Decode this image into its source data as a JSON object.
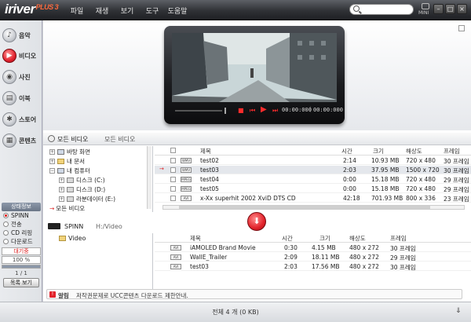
{
  "app": {
    "logo": "iriver",
    "logo_plus": "PLUS 3",
    "menu": [
      "파일",
      "재생",
      "보기",
      "도구",
      "도움말"
    ],
    "mini_label": "MINI"
  },
  "sidebar": {
    "items": [
      {
        "label": "음악",
        "icon": "music-note-icon"
      },
      {
        "label": "비디오",
        "icon": "video-icon"
      },
      {
        "label": "사진",
        "icon": "camera-icon"
      },
      {
        "label": "이북",
        "icon": "book-icon"
      },
      {
        "label": "스토어",
        "icon": "store-icon"
      },
      {
        "label": "콘텐츠",
        "icon": "contents-icon"
      }
    ],
    "active_index": 1
  },
  "status_panel": {
    "title": "상태정보",
    "options": [
      "SPINN",
      "전송",
      "CD 리핑",
      "다운로드"
    ],
    "selected_index": 0,
    "waiting": "대기중",
    "percent_text": "100 %",
    "progress_fraction": 1.0,
    "counter": "1 / 1",
    "list_button": "목록 보기"
  },
  "player": {
    "time_current": "00:00:000",
    "time_total": "00:00:000",
    "time_sep": "|"
  },
  "library": {
    "title": "모든 비디오",
    "subtitle": "모든 비디오",
    "tree": [
      {
        "label": "바탕 화면",
        "expander": "+",
        "icon": "desktop"
      },
      {
        "label": "내 문서",
        "expander": "+",
        "icon": "folder"
      },
      {
        "label": "내 컴퓨터",
        "expander": "−",
        "icon": "computer"
      },
      {
        "label": "디스크 (C:)",
        "expander": "+",
        "icon": "drive",
        "indent": 1
      },
      {
        "label": "디스크 (D:)",
        "expander": "+",
        "icon": "drive",
        "indent": 1
      },
      {
        "label": "라분데이터 (E:)",
        "expander": "+",
        "icon": "drive",
        "indent": 1
      }
    ],
    "tree_selected": "모든 비디오",
    "columns": [
      "제목",
      "시간",
      "크기",
      "해상도",
      "프레임"
    ],
    "rows": [
      {
        "fmt": "WMV",
        "title": "test02",
        "time": "2:14",
        "size": "10.93 MB",
        "res": "720 x 480",
        "fps": "30 프레임"
      },
      {
        "fmt": "WMV",
        "title": "test03",
        "time": "2:03",
        "size": "37.95 MB",
        "res": "1500 x 720",
        "fps": "30 프레임",
        "selected": true
      },
      {
        "fmt": "MPEG",
        "title": "test04",
        "time": "0:00",
        "size": "15.18 MB",
        "res": "720 x 480",
        "fps": "29 프레임"
      },
      {
        "fmt": "MPEG",
        "title": "test05",
        "time": "0:00",
        "size": "15.18 MB",
        "res": "720 x 480",
        "fps": "29 프레임"
      },
      {
        "fmt": "AVI",
        "title": "x-Xx superhit 2002 XviD DTS CD",
        "time": "42:18",
        "size": "701.93 MB",
        "res": "800 x 336",
        "fps": "23 프레임"
      }
    ]
  },
  "device": {
    "name": "SPINN",
    "path": "H:/Video",
    "folder": "Video",
    "columns": [
      "제목",
      "시간",
      "크기",
      "해상도",
      "프레임"
    ],
    "rows": [
      {
        "fmt": "AVI",
        "title": "iAMOLED Brand Movie",
        "time": "0:30",
        "size": "4.15 MB",
        "res": "480 x 272",
        "fps": "30 프레임"
      },
      {
        "fmt": "AVI",
        "title": "WallE_Trailer",
        "time": "2:09",
        "size": "18.11 MB",
        "res": "480 x 272",
        "fps": "29 프레임"
      },
      {
        "fmt": "AVI",
        "title": "test03",
        "time": "2:03",
        "size": "17.56 MB",
        "res": "480 x 272",
        "fps": "30 프레임"
      }
    ]
  },
  "notice": {
    "label": "알림",
    "text": "저작권문제로 UCC콘텐츠 다운로드 제한안내."
  },
  "footer": {
    "total": "전체 4 개 (0 KB)"
  },
  "colors": {
    "accent_red": "#e2232b",
    "title_bar": "#2f3135"
  }
}
